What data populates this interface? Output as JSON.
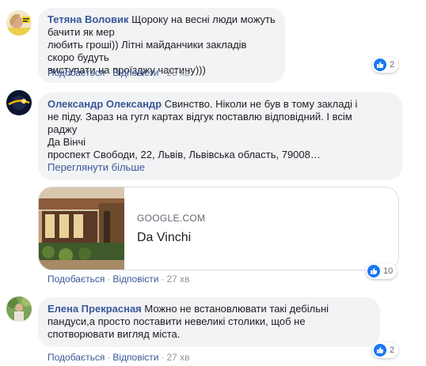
{
  "comments": [
    {
      "author": "Тетяна Воловик",
      "lines": [
        "Щороку на весні люди можуть бачити як мер",
        "любить гроші)) Літні майданчики закладів скоро будуть",
        "виступати на проїзджу частину)))"
      ],
      "actions": {
        "like": "Подобається",
        "reply": "Відповісти",
        "time": "28 хв"
      },
      "reaction_count": "2"
    },
    {
      "author": "Олександр Олександр",
      "lines": [
        "Свинство. Ніколи не був в тому закладі і",
        "не піду. Зараз на гугл картах відгук поставлю відповідний. І всім",
        "раджу",
        "Да Вінчі",
        "проспект Свободи, 22, Львів, Львівська область, 79008…"
      ],
      "see_more": "Переглянути більше",
      "link": {
        "domain": "GOOGLE.COM",
        "title": "Da Vinchi"
      },
      "actions": {
        "like": "Подобається",
        "reply": "Відповісти",
        "time": "27 хв"
      },
      "reaction_count": "10"
    },
    {
      "author": "Елена Прекрасная",
      "lines": [
        "Можно не встановлювати такі дебільні",
        "пандуси,а просто поставити невеликі столики, щоб не",
        "спотворювати вигляд міста."
      ],
      "actions": {
        "like": "Подобається",
        "reply": "Відповісти",
        "time": "27 хв"
      },
      "reaction_count": "2"
    }
  ],
  "colors": {
    "link": "#385898",
    "bubble": "#f2f3f5",
    "like": "#1877f2",
    "meta": "#90949c"
  },
  "icons": {
    "reaction": "thumbs-up-icon"
  }
}
